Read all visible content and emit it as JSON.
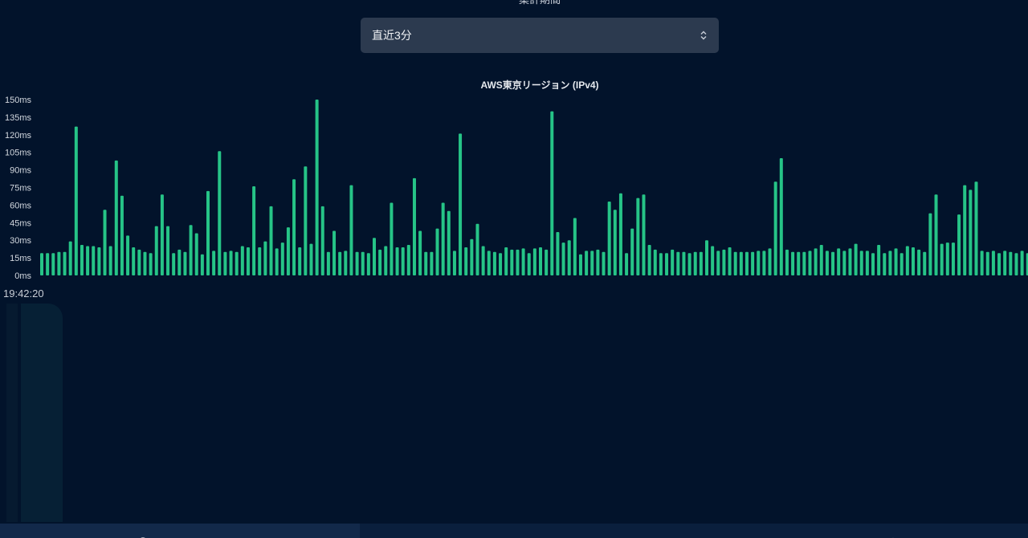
{
  "period": {
    "label": "集計期間",
    "selected": "直近3分"
  },
  "chart_data": {
    "type": "bar",
    "title": "AWS東京リージョン (IPv4)",
    "y_tick_labels": [
      "150ms",
      "135ms",
      "120ms",
      "105ms",
      "90ms",
      "75ms",
      "60ms",
      "45ms",
      "30ms",
      "15ms",
      "0ms"
    ],
    "ylim": [
      0,
      150
    ],
    "y_unit": "ms",
    "grid": false,
    "bar_color": "#26c487",
    "x_label_first": "19:42:20",
    "values": [
      19,
      19,
      19,
      20,
      20,
      29,
      127,
      26,
      25,
      25,
      24,
      56,
      25,
      98,
      68,
      34,
      24,
      22,
      20,
      19,
      42,
      69,
      42,
      19,
      22,
      20,
      43,
      36,
      18,
      72,
      21,
      106,
      20,
      21,
      20,
      25,
      24,
      76,
      24,
      29,
      59,
      23,
      28,
      41,
      82,
      24,
      93,
      27,
      150,
      59,
      20,
      38,
      20,
      21,
      77,
      20,
      20,
      19,
      32,
      22,
      25,
      62,
      24,
      24,
      26,
      83,
      38,
      20,
      20,
      40,
      62,
      55,
      21,
      121,
      24,
      31,
      44,
      25,
      21,
      20,
      19,
      24,
      22,
      22,
      23,
      19,
      23,
      24,
      22,
      140,
      37,
      28,
      30,
      49,
      18,
      21,
      21,
      22,
      20,
      63,
      56,
      70,
      19,
      40,
      66,
      69,
      26,
      22,
      19,
      19,
      22,
      20,
      20,
      19,
      20,
      20,
      30,
      25,
      21,
      22,
      24,
      20,
      20,
      20,
      20,
      21,
      21,
      23,
      80,
      100,
      22,
      20,
      20,
      20,
      21,
      23,
      26,
      21,
      20,
      23,
      21,
      23,
      27,
      21,
      21,
      19,
      26,
      19,
      21,
      23,
      19,
      25,
      24,
      22,
      20,
      53,
      69,
      27,
      28,
      28,
      52,
      77,
      73,
      80,
      21,
      20,
      21,
      19,
      21,
      20,
      19,
      21,
      19
    ]
  },
  "colors": {
    "background": "#02132b",
    "select_bg": "#2c3a4f",
    "bar": "#26c487"
  }
}
